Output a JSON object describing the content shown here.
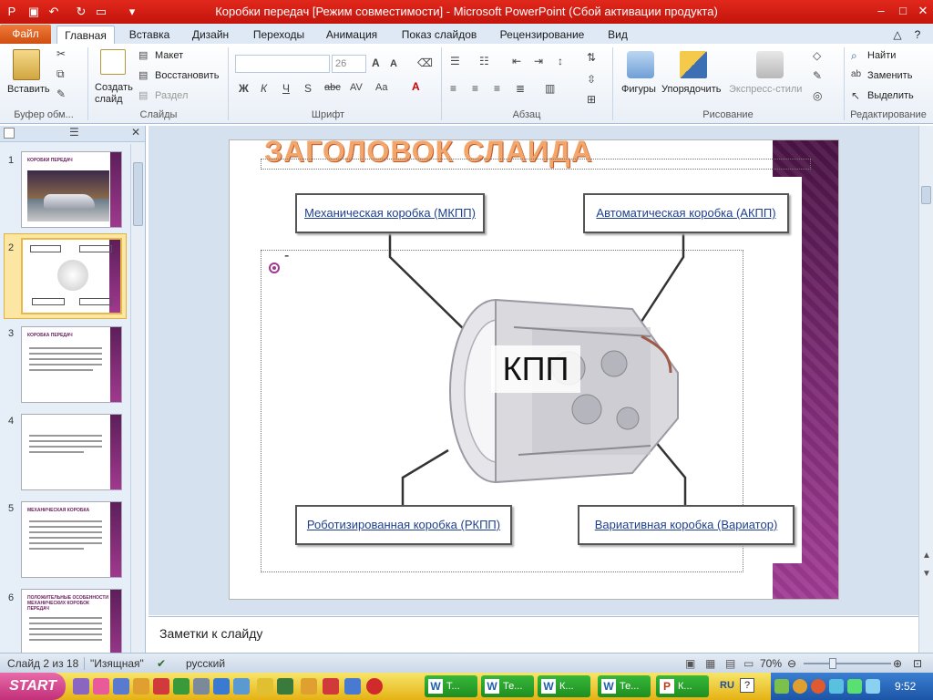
{
  "window": {
    "title": "Коробки передач [Режим совместимости] - Microsoft PowerPoint (Сбой активации продукта)"
  },
  "ribbon_tabs": [
    "Файл",
    "Главная",
    "Вставка",
    "Дизайн",
    "Переходы",
    "Анимация",
    "Показ слайдов",
    "Рецензирование",
    "Вид"
  ],
  "ribbon": {
    "paste_label": "Вставить",
    "clipboard_group": "Буфер обм...",
    "new_slide_label": "Создать\nслайд",
    "layout_label": "Макет",
    "reset_label": "Восстановить",
    "section_label": "Раздел",
    "slides_group": "Слайды",
    "font_size": "26",
    "font_group": "Шрифт",
    "paragraph_group": "Абзац",
    "shapes_label": "Фигуры",
    "arrange_label": "Упорядочить",
    "quick_styles_label": "Экспресс-стили",
    "drawing_group": "Рисование",
    "find_label": "Найти",
    "replace_label": "Заменить",
    "select_label": "Выделить",
    "editing_group": "Редактирование"
  },
  "thumbnails": [
    {
      "num": "1",
      "title": "КОРОБКИ ПЕРЕДАЧ"
    },
    {
      "num": "2",
      "title": ""
    },
    {
      "num": "3",
      "title": "КОРОБКА ПЕРЕДАЧ"
    },
    {
      "num": "4",
      "title": ""
    },
    {
      "num": "5",
      "title": "МЕХАНИЧЕСКАЯ КОРОБКА"
    },
    {
      "num": "6",
      "title": "ПОЛОЖИТЕЛЬНЫЕ ОСОБЕННОСТИ МЕХАНИЧЕСКИХ КОРОБОК ПЕРЕДАЧ"
    }
  ],
  "slide": {
    "title": "ЗАГОЛОВОК СЛАЙДА",
    "bullet_text": "-",
    "center_label": "КПП",
    "boxes": {
      "manual": "Механическая коробка (МКПП)",
      "automatic": "Автоматическая коробка (АКПП)",
      "robotic": "Роботизированная коробка (РКПП)",
      "variator": "Вариативная коробка (Вариатор)"
    }
  },
  "notes": {
    "placeholder": "Заметки к слайду"
  },
  "status": {
    "slide_info": "Слайд 2 из 18",
    "theme": "\"Изящная\"",
    "language": "русский",
    "zoom": "70%"
  },
  "taskbar": {
    "start": "START",
    "items": [
      {
        "icon": "W",
        "label": "Т..."
      },
      {
        "icon": "W",
        "label": "Те..."
      },
      {
        "icon": "W",
        "label": "К..."
      },
      {
        "icon": "W",
        "label": "Те..."
      },
      {
        "icon": "P",
        "label": "К..."
      }
    ],
    "lang": "RU",
    "time": "9:52"
  }
}
